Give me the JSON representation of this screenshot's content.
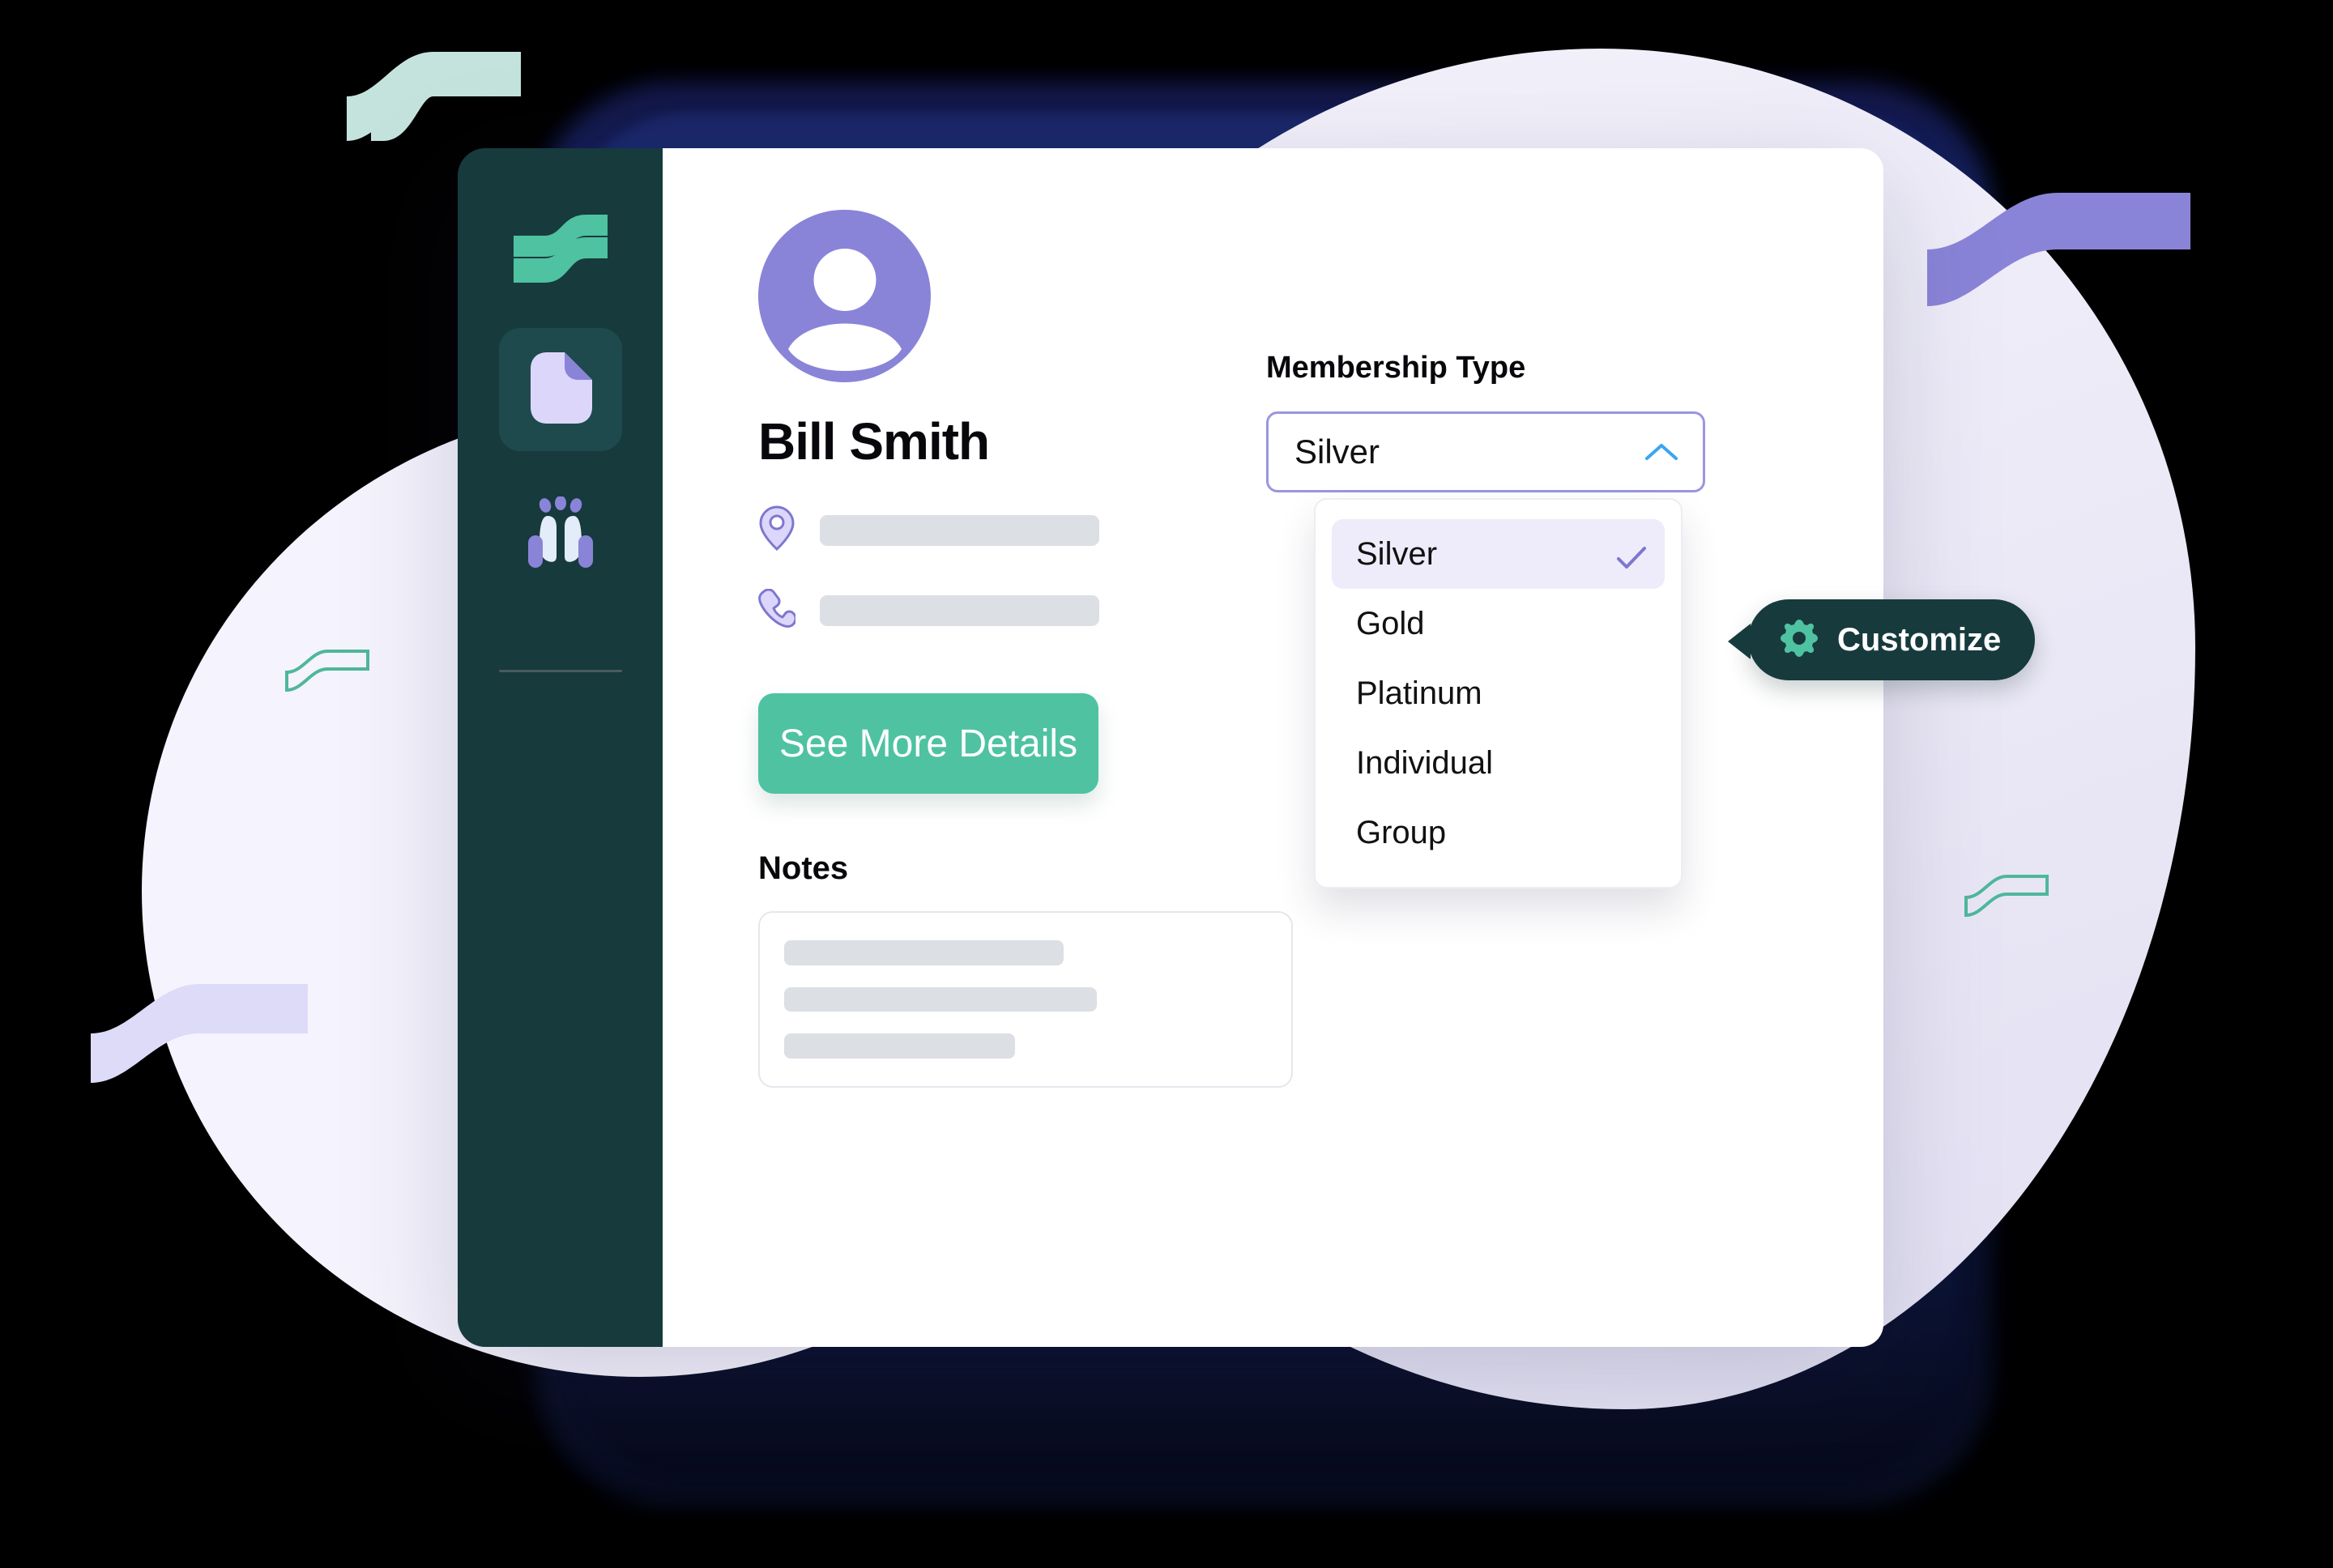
{
  "sidebar": {
    "logo_name": "wave-logo",
    "items": [
      {
        "name": "document",
        "icon": "document-icon",
        "active": true
      },
      {
        "name": "cheers",
        "icon": "cheers-glasses-icon",
        "active": false
      }
    ]
  },
  "profile": {
    "avatar_icon": "user-avatar-icon",
    "name": "Bill Smith",
    "fields": [
      {
        "icon": "location-pin-icon",
        "value": ""
      },
      {
        "icon": "phone-icon",
        "value": ""
      }
    ],
    "cta_label": "See More Details"
  },
  "notes": {
    "title": "Notes",
    "lines": [
      "",
      "",
      ""
    ]
  },
  "membership": {
    "label": "Membership Type",
    "selected": "Silver",
    "chevron_icon": "chevron-up-icon",
    "options": [
      {
        "label": "Silver",
        "selected": true
      },
      {
        "label": "Gold",
        "selected": false
      },
      {
        "label": "Platinum",
        "selected": false
      },
      {
        "label": "Individual",
        "selected": false
      },
      {
        "label": "Group",
        "selected": false
      }
    ]
  },
  "tooltip": {
    "icon": "gear-icon",
    "label": "Customize"
  },
  "colors": {
    "sidebar": "#173a3d",
    "sidebar_active": "#1e4a4d",
    "accent_green": "#4fc2a1",
    "accent_purple": "#8a84d8",
    "select_border": "#9b95e0",
    "navy_frame": "#12275f",
    "chevron_blue": "#3aa6f0",
    "placeholder_gray": "#dcdfe3",
    "mint_decor": "#c4e3dc",
    "lavender_decor": "#dedbf8"
  }
}
